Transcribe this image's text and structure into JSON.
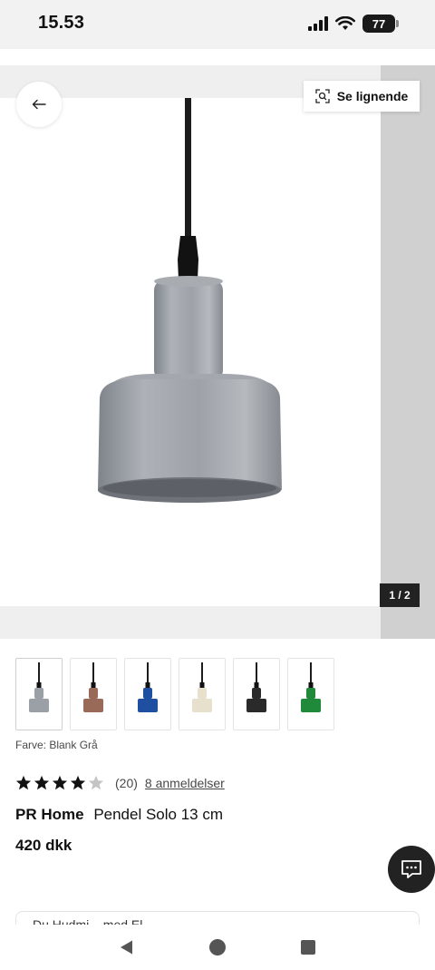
{
  "status_bar": {
    "time": "15.53",
    "battery": "77"
  },
  "gallery": {
    "similar_label": "Se lignende",
    "counter": "1 / 2"
  },
  "thumbnails": [
    {
      "color": "#9aa0a6",
      "name": "Blank Grå"
    },
    {
      "color": "#9a6a58",
      "name": "brown"
    },
    {
      "color": "#1f4fa0",
      "name": "blue"
    },
    {
      "color": "#e6e0cc",
      "name": "cream"
    },
    {
      "color": "#2a2a2a",
      "name": "black"
    },
    {
      "color": "#1e8a3a",
      "name": "green"
    }
  ],
  "product": {
    "color_label": "Farve: Blank Grå",
    "rating_value": 4,
    "rating_max": 5,
    "rating_count": "(20)",
    "reviews_link": "8 anmeldelser",
    "brand": "PR Home",
    "name": "Pendel Solo 13 cm",
    "price": "420 dkk"
  },
  "cutoff_card_text": "Du Hudmi... med El...",
  "colors": {
    "lamp_gray": "#9ea2a8",
    "accent_dark": "#222222"
  }
}
